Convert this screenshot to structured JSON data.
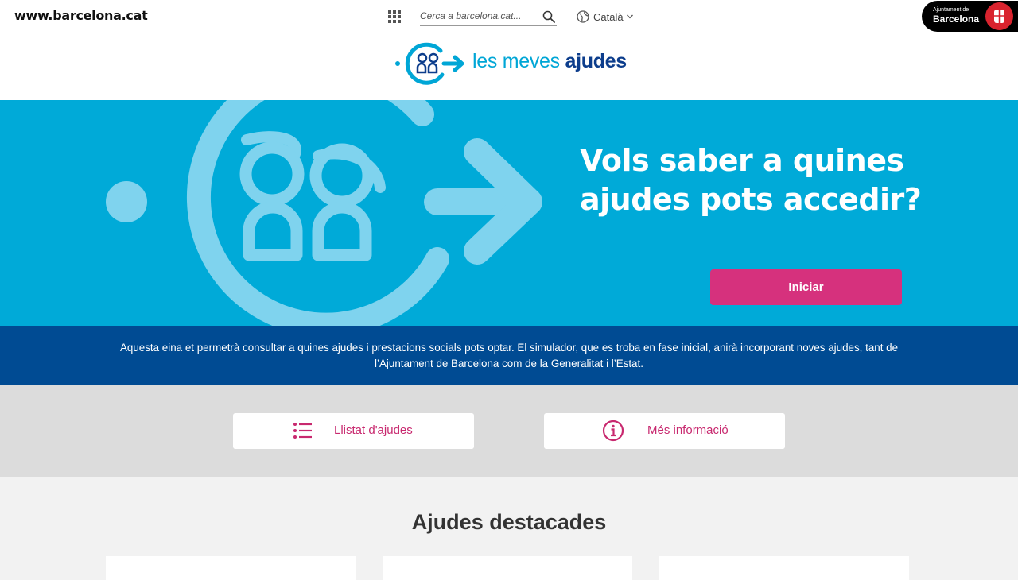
{
  "topbar": {
    "site_link": "www.barcelona.cat",
    "search_placeholder": "Cerca a barcelona.cat...",
    "language": "Català",
    "logo_small": "Ajuntament de",
    "logo_big": "Barcelona"
  },
  "brand": {
    "text_light": "les meves ",
    "text_bold": "ajudes"
  },
  "hero": {
    "title": "Vols saber a quines ajudes pots accedir?",
    "button": "Iniciar"
  },
  "info": {
    "text": "Aquesta eina et permetrà consultar a quines ajudes i prestacions socials pots optar. El simulador, que es troba en fase inicial, anirà incorporant noves ajudes, tant de l’Ajuntament de Barcelona com de la Generalitat i l’Estat."
  },
  "links": {
    "list_label": "Llistat d'ajudes",
    "info_label": "Més informació"
  },
  "featured": {
    "title": "Ajudes destacades"
  },
  "colors": {
    "primary_blue": "#00aad8",
    "dark_blue": "#004b93",
    "accent_pink": "#d6317d",
    "brand_navy": "#0c3d8c"
  },
  "icons": [
    "apps-grid-icon",
    "search-icon",
    "globe-icon",
    "chevron-down-icon",
    "list-icon",
    "info-icon"
  ]
}
